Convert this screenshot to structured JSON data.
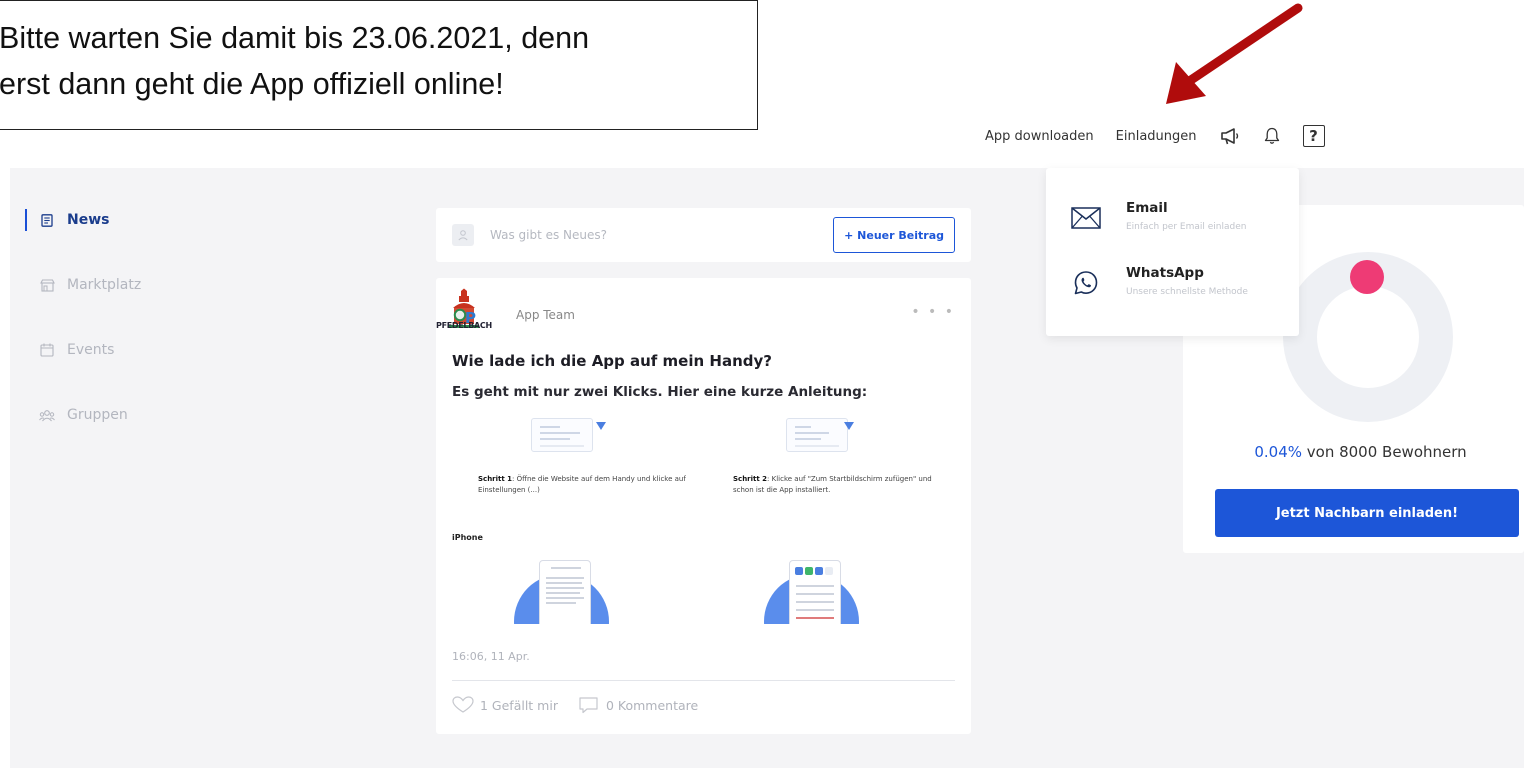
{
  "annotation": {
    "line1": "Bitte warten Sie damit bis 23.06.2021, denn",
    "line2": "erst dann geht die App offiziell online!",
    "arrow_color": "#b00c0c"
  },
  "topnav": {
    "app_download": "App downloaden",
    "invitations": "Einladungen",
    "help_symbol": "?",
    "icons": [
      "megaphone-icon",
      "bell-icon",
      "help-icon"
    ]
  },
  "sidebar": {
    "items": [
      {
        "label": "News",
        "icon": "news-icon",
        "active": true
      },
      {
        "label": "Marktplatz",
        "icon": "store-icon",
        "active": false
      },
      {
        "label": "Events",
        "icon": "calendar-icon",
        "active": false
      },
      {
        "label": "Gruppen",
        "icon": "group-icon",
        "active": false
      }
    ]
  },
  "composer": {
    "placeholder": "Was gibt es Neues?",
    "new_post_label": "+ Neuer Beitrag"
  },
  "post": {
    "logo_text": "PFEDELBACH",
    "author": "App Team",
    "more": "• • •",
    "title": "Wie lade ich die App auf mein Handy?",
    "subtitle": "Es geht mit nur zwei Klicks. Hier eine kurze Anleitung:",
    "step1_bold": "Schritt 1",
    "step1_text": ": Öffne die Website auf dem Handy und klicke auf Einstellungen (...)",
    "step2_bold": "Schritt 2",
    "step2_text": ": Klicke auf \"Zum Startbildschirm zufügen\" und schon ist die App installiert.",
    "iphone_label": "iPhone",
    "date": "16:06, 11 Apr.",
    "likes": "1 Gefällt mir",
    "comments": "0 Kommentare"
  },
  "invite_menu": {
    "items": [
      {
        "title": "Email",
        "subtitle": "Einfach per Email einladen",
        "icon": "mail-icon"
      },
      {
        "title": "WhatsApp",
        "subtitle": "Unsere schnellste Methode",
        "icon": "whatsapp-icon"
      }
    ]
  },
  "stats": {
    "percent": "0.04%",
    "suffix": " von 8000 Bewohnern",
    "progress_fraction": 0.0004,
    "invite_button": "Jetzt Nachbarn einladen!"
  },
  "colors": {
    "accent": "#1d56d8",
    "donut_marker": "#ee3b75",
    "arrow": "#b00c0c"
  }
}
